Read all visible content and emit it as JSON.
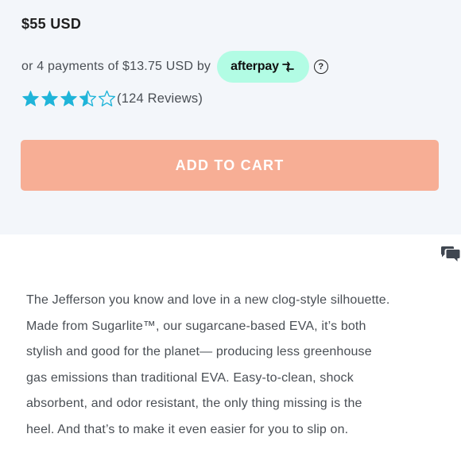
{
  "product": {
    "price": "$55 USD",
    "installments_text": "or 4 payments of $13.75 USD by",
    "afterpay_label": "afterpay",
    "info_icon": "question-circle-icon",
    "rating": 3.5,
    "rating_max": 5,
    "reviews_text": "(124 Reviews)",
    "add_to_cart_label": "ADD TO CART"
  },
  "colors": {
    "panel_bg": "#f3f6fa",
    "star": "#1fb4d9",
    "afterpay_badge": "#b2fce4",
    "button": "#f7ae95"
  },
  "chat_icon": "chat-bubbles-icon",
  "description": {
    "lines": [
      "The Jefferson you know and love in a new clog-style silhouette.",
      "Made from Sugarlite™, our sugarcane-based EVA, it’s both",
      "stylish and good for the planet— producing less greenhouse",
      "gas emissions than traditional EVA. Easy-to-clean, shock",
      "absorbent, and odor resistant, the only thing missing is the",
      "heel. And that’s to make it even easier for you to slip on."
    ]
  }
}
